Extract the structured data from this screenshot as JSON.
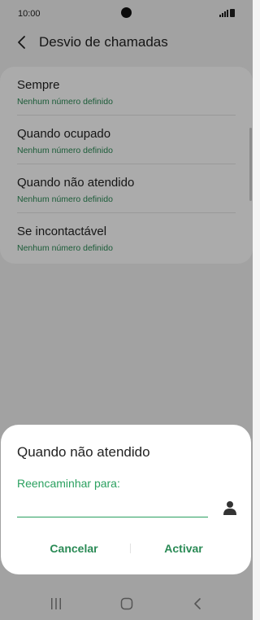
{
  "status_bar": {
    "time": "10:00"
  },
  "header": {
    "title": "Desvio de chamadas",
    "back_icon": "chevron-left-icon"
  },
  "call_forwarding": {
    "items": [
      {
        "title": "Sempre",
        "subtitle": "Nenhum número definido"
      },
      {
        "title": "Quando ocupado",
        "subtitle": "Nenhum número definido"
      },
      {
        "title": "Quando não atendido",
        "subtitle": "Nenhum número definido"
      },
      {
        "title": "Se incontactável",
        "subtitle": "Nenhum número definido"
      }
    ]
  },
  "dialog": {
    "title": "Quando não atendido",
    "label": "Reencaminhar para:",
    "input_value": "",
    "contact_icon": "person-icon",
    "cancel_label": "Cancelar",
    "activate_label": "Activar"
  },
  "navigation": {
    "icons": [
      "recents-icon",
      "home-icon",
      "back-icon"
    ]
  },
  "colors": {
    "accent": "#2a8a55",
    "accent_line": "#2aa05f",
    "overlay": "rgba(0,0,0,0.33)"
  }
}
